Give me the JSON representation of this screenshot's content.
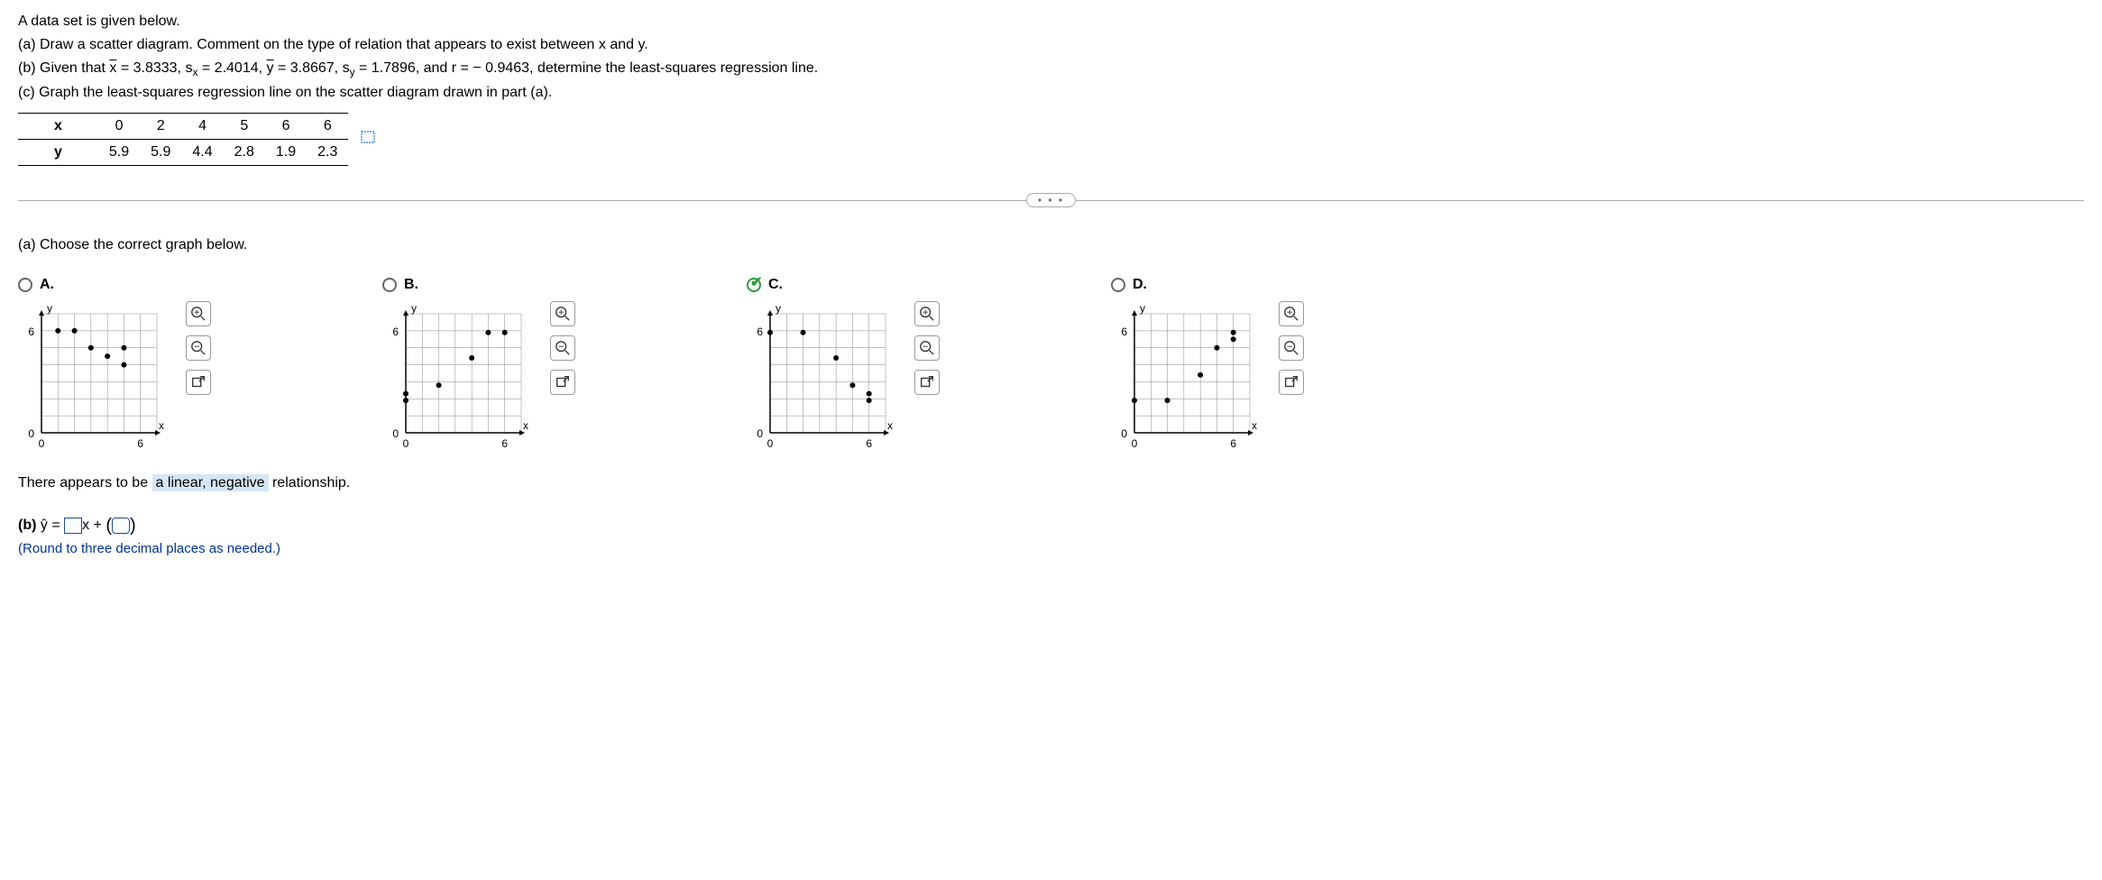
{
  "intro": {
    "line1": "A data set is given below.",
    "a": "(a) Draw a scatter diagram. Comment on the type of relation that appears to exist between x and y.",
    "b_prefix": "(b) Given that ",
    "b_xbar_label": "x",
    "b_xbar": " = 3.8333, s",
    "b_sx_sub": "x",
    "b_sx_val": " = 2.4014, ",
    "b_ybar_label": "y",
    "b_ybar": " = 3.8667, s",
    "b_sy_sub": "y",
    "b_sy_val": " = 1.7896, and r =  − 0.9463, determine the least-squares regression line.",
    "c": "(c) Graph the least-squares regression line on the scatter diagram drawn in part (a)."
  },
  "table": {
    "rowx": "x",
    "rowy": "y",
    "x": [
      "0",
      "2",
      "4",
      "5",
      "6",
      "6"
    ],
    "y": [
      "5.9",
      "5.9",
      "4.4",
      "2.8",
      "1.9",
      "2.3"
    ]
  },
  "partA": {
    "prompt": "(a) Choose the correct graph below.",
    "options": {
      "A": "A.",
      "B": "B.",
      "C": "C.",
      "D": "D."
    }
  },
  "axes": {
    "xlabel": "x",
    "ylabel": "y",
    "x0": "0",
    "xmax": "6",
    "y0": "0",
    "ymax": "6"
  },
  "chart_data": [
    {
      "type": "scatter",
      "option": "A",
      "title": "",
      "xlabel": "x",
      "ylabel": "y",
      "xlim": [
        0,
        7
      ],
      "ylim": [
        0,
        7
      ],
      "points": [
        [
          1,
          6
        ],
        [
          2,
          6
        ],
        [
          3,
          5
        ],
        [
          4,
          4.5
        ],
        [
          5,
          4
        ],
        [
          5,
          5
        ]
      ]
    },
    {
      "type": "scatter",
      "option": "B",
      "title": "",
      "xlabel": "x",
      "ylabel": "y",
      "xlim": [
        0,
        7
      ],
      "ylim": [
        0,
        7
      ],
      "points": [
        [
          0,
          2.3
        ],
        [
          0,
          1.9
        ],
        [
          2,
          2.8
        ],
        [
          4,
          4.4
        ],
        [
          5,
          5.9
        ],
        [
          6,
          5.9
        ]
      ]
    },
    {
      "type": "scatter",
      "option": "C",
      "title": "",
      "xlabel": "x",
      "ylabel": "y",
      "xlim": [
        0,
        7
      ],
      "ylim": [
        0,
        7
      ],
      "points": [
        [
          0,
          5.9
        ],
        [
          2,
          5.9
        ],
        [
          4,
          4.4
        ],
        [
          5,
          2.8
        ],
        [
          6,
          1.9
        ],
        [
          6,
          2.3
        ]
      ]
    },
    {
      "type": "scatter",
      "option": "D",
      "title": "",
      "xlabel": "x",
      "ylabel": "y",
      "xlim": [
        0,
        7
      ],
      "ylim": [
        0,
        7
      ],
      "points": [
        [
          0,
          1.9
        ],
        [
          2,
          1.9
        ],
        [
          4,
          3.4
        ],
        [
          5,
          5
        ],
        [
          6,
          5.9
        ],
        [
          6,
          5.5
        ]
      ]
    }
  ],
  "sentence": {
    "pre": "There appears to be ",
    "answer": "a linear, negative",
    "post": " relationship."
  },
  "partB": {
    "prefix": "(b) ",
    "yhat": "ŷ",
    "eq": " = ",
    "mid": "x + ",
    "instruction": "(Round to three decimal places as needed.)"
  },
  "tools": {
    "zoomin": "zoom-in",
    "zoomout": "zoom-out",
    "pop": "open-external"
  }
}
